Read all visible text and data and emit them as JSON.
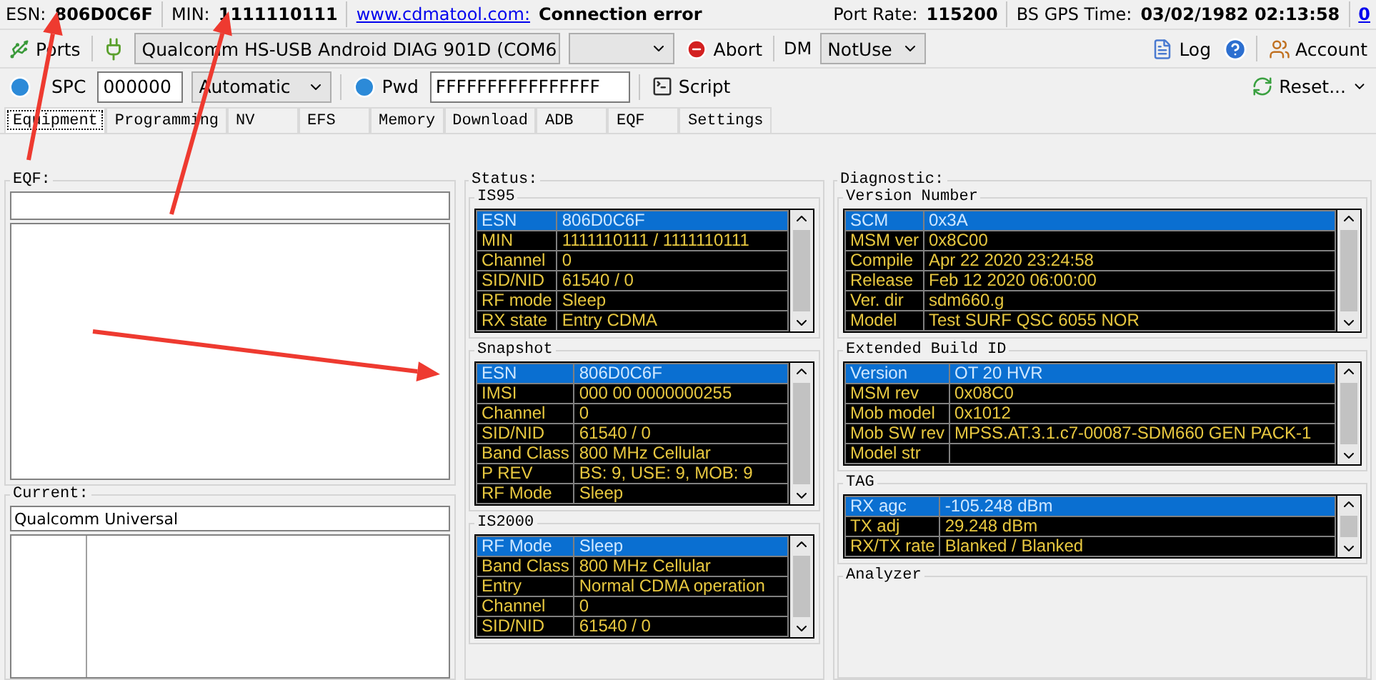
{
  "info_bar": {
    "fields": [
      {
        "label": "ESN:",
        "value": "806D0C6F"
      },
      {
        "label": "MIN:",
        "value": "1111110111"
      }
    ],
    "link": "www.cdmatool.com:",
    "status": "Connection error",
    "port_rate": {
      "label": "Port Rate:",
      "value": "115200"
    },
    "gps_time": {
      "label": "BS GPS Time:",
      "value": "03/02/1982 02:13:58"
    },
    "counter": "0"
  },
  "toolbar": {
    "ports": "Ports",
    "port_select": "Qualcomm HS-USB Android DIAG 901D (COM6",
    "abort": "Abort",
    "dm_label": "DM",
    "dm_select": "NotUse",
    "log": "Log",
    "account": "Account"
  },
  "toolbar2": {
    "spc": "SPC",
    "spc_value": "000000",
    "mode": "Automatic",
    "pwd": "Pwd",
    "pwd_value": "FFFFFFFFFFFFFFFF",
    "script": "Script",
    "reset": "Reset..."
  },
  "tabs": [
    {
      "label": "Equipment",
      "selected": true
    },
    {
      "label": "Programming",
      "selected": false
    },
    {
      "label": "NV",
      "selected": false
    },
    {
      "label": "EFS",
      "selected": false
    },
    {
      "label": "Memory",
      "selected": false
    },
    {
      "label": "Download",
      "selected": false
    },
    {
      "label": "ADB",
      "selected": false
    },
    {
      "label": "EQF",
      "selected": false
    },
    {
      "label": "Settings",
      "selected": false
    }
  ],
  "left": {
    "eqf_label": "EQF:",
    "current_label": "Current:",
    "current_value": "Qualcomm Universal"
  },
  "status": {
    "title": "Status:",
    "groups": [
      {
        "title": "IS95",
        "kind": "table",
        "rows": [
          {
            "label": "ESN",
            "value": "806D0C6F",
            "selected": true
          },
          {
            "label": "MIN",
            "value": "1111110111 / 1111110111",
            "selected": false
          },
          {
            "label": "Channel",
            "value": "0",
            "selected": false
          },
          {
            "label": "SID/NID",
            "value": "61540 / 0",
            "selected": false
          },
          {
            "label": "RF mode",
            "value": "Sleep",
            "selected": false
          },
          {
            "label": "RX state",
            "value": "Entry CDMA",
            "selected": false
          }
        ]
      },
      {
        "title": "Snapshot",
        "kind": "table",
        "rows": [
          {
            "label": "ESN",
            "value": "806D0C6F",
            "selected": true
          },
          {
            "label": "IMSI",
            "value": "000 00 0000000255",
            "selected": false
          },
          {
            "label": "Channel",
            "value": "0",
            "selected": false
          },
          {
            "label": "SID/NID",
            "value": "61540 / 0",
            "selected": false
          },
          {
            "label": "Band Class",
            "value": "800 MHz Cellular",
            "selected": false
          },
          {
            "label": "P REV",
            "value": "BS: 9, USE: 9, MOB: 9",
            "selected": false
          },
          {
            "label": "RF Mode",
            "value": "Sleep",
            "selected": false
          }
        ]
      },
      {
        "title": "IS2000",
        "kind": "table",
        "rows": [
          {
            "label": "RF Mode",
            "value": "Sleep",
            "selected": true
          },
          {
            "label": "Band Class",
            "value": "800 MHz Cellular",
            "selected": false
          },
          {
            "label": "Entry",
            "value": "Normal CDMA operation",
            "selected": false
          },
          {
            "label": "Channel",
            "value": "0",
            "selected": false
          },
          {
            "label": "SID/NID",
            "value": "61540 / 0",
            "selected": false
          }
        ]
      }
    ]
  },
  "diagnostic": {
    "title": "Diagnostic:",
    "groups": [
      {
        "title": "Version Number",
        "kind": "table",
        "rows": [
          {
            "label": "SCM",
            "value": "0x3A",
            "selected": true
          },
          {
            "label": "MSM ver",
            "value": "0x8C00",
            "selected": false
          },
          {
            "label": "Compile",
            "value": "Apr 22 2020 23:24:58",
            "selected": false
          },
          {
            "label": "Release",
            "value": "Feb 12 2020 06:00:00",
            "selected": false
          },
          {
            "label": "Ver. dir",
            "value": "sdm660.g",
            "selected": false
          },
          {
            "label": "Model",
            "value": "Test SURF QSC 6055 NOR",
            "selected": false
          }
        ]
      },
      {
        "title": "Extended Build ID",
        "kind": "table",
        "rows": [
          {
            "label": "Version",
            "value": "OT 20 HVR",
            "selected": true
          },
          {
            "label": "MSM rev",
            "value": "0x08C0",
            "selected": false
          },
          {
            "label": "Mob model",
            "value": "0x1012",
            "selected": false
          },
          {
            "label": "Mob SW rev",
            "value": "MPSS.AT.3.1.c7-00087-SDM660 GEN PACK-1",
            "selected": false
          },
          {
            "label": "Model str",
            "selected": false
          }
        ]
      },
      {
        "title": "TAG",
        "kind": "table",
        "rows": [
          {
            "label": "RX agc",
            "value": "-105.248 dBm",
            "selected": true
          },
          {
            "label": "TX adj",
            "value": "29.248 dBm",
            "selected": false
          },
          {
            "label": "RX/TX rate",
            "value": "Blanked / Blanked",
            "selected": false
          }
        ]
      },
      {
        "title": "Analyzer",
        "kind": "panel"
      }
    ]
  }
}
